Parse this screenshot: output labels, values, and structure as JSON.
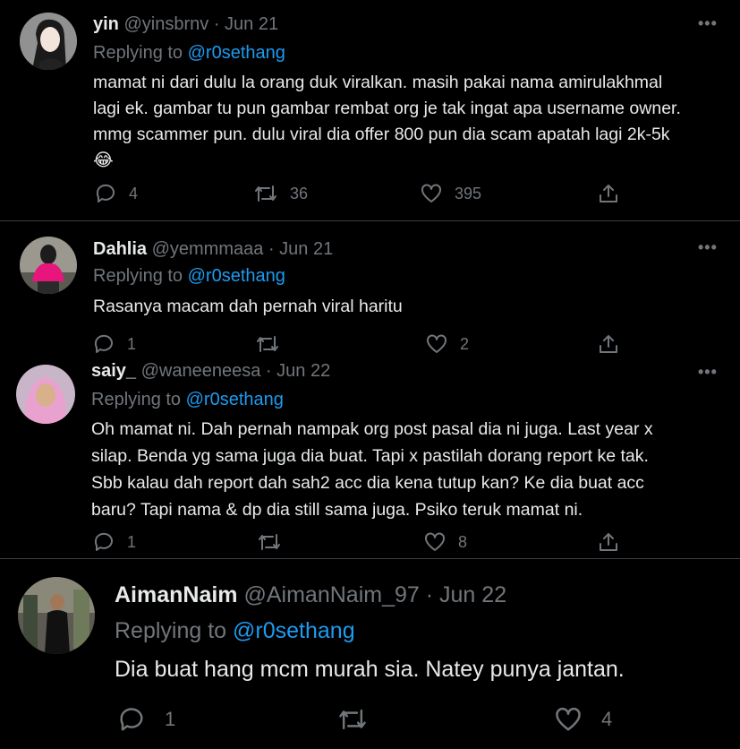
{
  "tweets": [
    {
      "name": "yin",
      "handle": "@yinsbrnv",
      "dot": "·",
      "date": "Jun 21",
      "reply_prefix": "Replying to",
      "mention": "@r0sethang",
      "lines": [
        "mamat ni dari dulu la orang duk viralkan. masih pakai nama amirulakhmal",
        "lagi ek. gambar tu pun gambar rembat org je tak ingat apa username owner.",
        "mmg scammer pun. dulu viral dia offer 800 pun dia scam apatah lagi 2k-5k",
        "😂"
      ],
      "more": "•••",
      "replies": "4",
      "retweets": "36",
      "likes": "395"
    },
    {
      "name": "Dahlia",
      "handle": "@yemmmaaa",
      "dot": "·",
      "date": "Jun 21",
      "reply_prefix": "Replying to",
      "mention": "@r0sethang",
      "lines": [
        "Rasanya macam dah pernah viral haritu"
      ],
      "more": "•••",
      "replies": "1",
      "retweets": "",
      "likes": "2"
    },
    {
      "name": "saiy_",
      "handle": "@waneeneesa",
      "dot": "·",
      "date": "Jun 22",
      "reply_prefix": "Replying to",
      "mention": "@r0sethang",
      "lines": [
        "Oh mamat ni. Dah pernah nampak org post pasal dia ni juga. Last year x",
        "silap. Benda yg sama juga dia buat. Tapi x pastilah dorang report ke tak.",
        "Sbb kalau dah report dah sah2 acc dia kena tutup kan? Ke dia buat acc",
        "baru? Tapi nama & dp dia still sama juga. Psiko teruk mamat ni."
      ],
      "more": "•••",
      "replies": "1",
      "retweets": "",
      "likes": "8"
    },
    {
      "name": "AimanNaim",
      "handle": "@AimanNaim_97",
      "dot": "·",
      "date": "Jun 22",
      "reply_prefix": "Replying to",
      "mention": "@r0sethang",
      "lines": [
        "Dia buat hang mcm murah sia. Natey punya jantan."
      ],
      "more": "",
      "replies": "1",
      "retweets": "",
      "likes": "4"
    }
  ],
  "icons": {
    "reply": "reply-icon",
    "retweet": "retweet-icon",
    "like": "heart-icon",
    "share": "share-icon",
    "more": "more-icon"
  },
  "colors": {
    "background": "#000000",
    "text": "#e7e9ea",
    "muted": "#71767b",
    "link": "#1d9bf0",
    "separator": "#3b3f44"
  }
}
